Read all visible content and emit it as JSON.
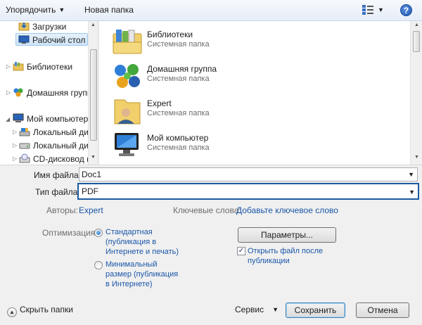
{
  "toolbar": {
    "organize_label": "Упорядочить",
    "new_folder_label": "Новая папка",
    "view_icon": "view-options-icon",
    "help_label": "?"
  },
  "nav": {
    "items": [
      {
        "label": "Загрузки",
        "icon": "downloads-folder-icon"
      },
      {
        "label": "Рабочий стол",
        "icon": "desktop-icon"
      },
      {
        "label": "Библиотеки",
        "icon": "libraries-icon"
      },
      {
        "label": "Домашняя группа",
        "icon": "homegroup-icon"
      },
      {
        "label": "Мой компьютер",
        "icon": "computer-icon"
      },
      {
        "label": "Локальный диск",
        "icon": "local-disk-icon"
      },
      {
        "label": "Локальный диск",
        "icon": "local-disk-icon"
      },
      {
        "label": "CD-дисковод (E:",
        "icon": "cd-drive-icon"
      }
    ]
  },
  "files": {
    "items": [
      {
        "name": "Библиотеки",
        "type": "Системная папка",
        "icon": "libraries-folder-icon"
      },
      {
        "name": "Домашняя группа",
        "type": "Системная папка",
        "icon": "homegroup-icon"
      },
      {
        "name": "Expert",
        "type": "Системная папка",
        "icon": "user-folder-icon"
      },
      {
        "name": "Мой компьютер",
        "type": "Системная папка",
        "icon": "computer-icon"
      }
    ]
  },
  "form": {
    "filename_label": "Имя файла:",
    "filename_value": "Doc1",
    "filetype_label": "Тип файла:",
    "filetype_value": "PDF",
    "authors_label": "Авторы:",
    "authors_value": "Expert",
    "keywords_label": "Ключевые слова:",
    "keywords_value": "Добавьте ключевое слово",
    "optimization_label": "Оптимизация:",
    "opt_standard_line1": "Стандартная",
    "opt_standard_line2": "(публикация в",
    "opt_standard_line3": "Интернете и печать)",
    "opt_minimal_line1": "Минимальный",
    "opt_minimal_line2": "размер (публикация",
    "opt_minimal_line3": "в Интернете)",
    "options_button": "Параметры...",
    "open_after_line1": "Открыть файл после",
    "open_after_line2": "публикации",
    "open_after_checked": "✓"
  },
  "footer": {
    "hide_folders_label": "Скрыть папки",
    "hide_folders_icon": "▲",
    "service_label": "Сервис",
    "save_button": "Сохранить",
    "cancel_button": "Отмена"
  }
}
